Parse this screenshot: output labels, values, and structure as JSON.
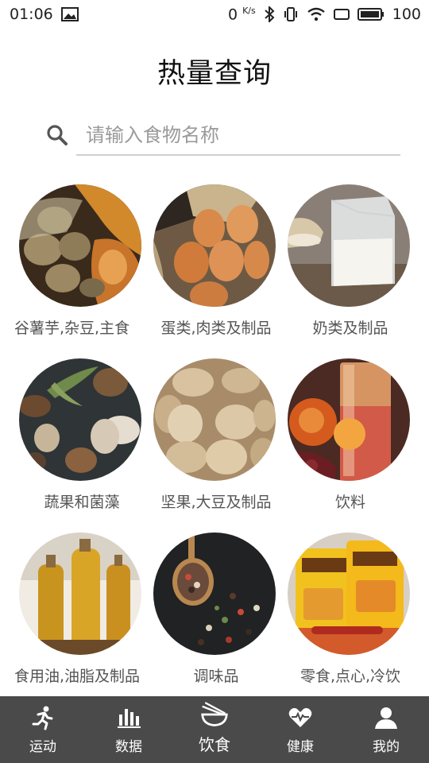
{
  "status_bar": {
    "time": "01:06",
    "net_speed": "0",
    "net_unit": "K/s",
    "battery": "100"
  },
  "page": {
    "title": "热量查询"
  },
  "search": {
    "placeholder": "请输入食物名称",
    "value": ""
  },
  "categories": [
    {
      "label": "谷薯芋,杂豆,主食",
      "image": "potatoes-pumpkin"
    },
    {
      "label": "蛋类,肉类及制品",
      "image": "eggs"
    },
    {
      "label": "奶类及制品",
      "image": "milk-carton"
    },
    {
      "label": "蔬果和菌藻",
      "image": "mushrooms"
    },
    {
      "label": "坚果,大豆及制品",
      "image": "almonds"
    },
    {
      "label": "饮料",
      "image": "juice-glass"
    },
    {
      "label": "食用油,油脂及制品",
      "image": "oil-bottles"
    },
    {
      "label": "调味品",
      "image": "peppercorn-spoon"
    },
    {
      "label": "零食,点心,冷饮",
      "image": "snack-bags"
    }
  ],
  "bottom_nav": [
    {
      "label": "运动",
      "icon": "runner-icon",
      "active": false
    },
    {
      "label": "数据",
      "icon": "bar-chart-icon",
      "active": false
    },
    {
      "label": "饮食",
      "icon": "bowl-chopsticks-icon",
      "active": true
    },
    {
      "label": "健康",
      "icon": "heart-pulse-icon",
      "active": false
    },
    {
      "label": "我的",
      "icon": "person-icon",
      "active": false
    }
  ],
  "colors": {
    "nav_bg": "#4a4a4a",
    "nav_text": "#ffffff",
    "label_text": "#555555"
  }
}
